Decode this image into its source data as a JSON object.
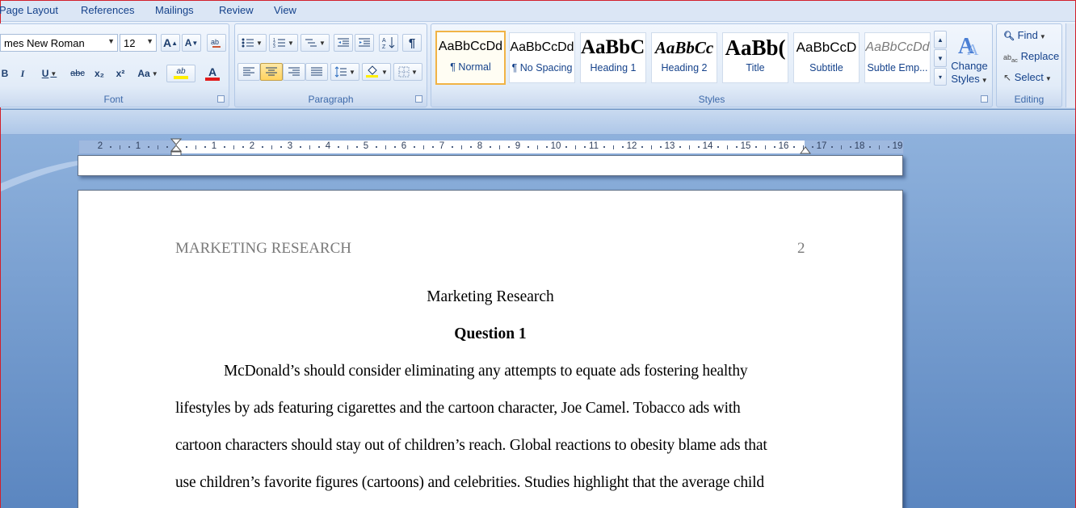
{
  "tabs": [
    "Page Layout",
    "References",
    "Mailings",
    "Review",
    "View"
  ],
  "font": {
    "name": "mes New Roman",
    "size": "12",
    "grow_label": "A",
    "shrink_label": "A",
    "bold": "B",
    "italic": "I",
    "underline": "U",
    "strikethrough": "abc",
    "subscript": "x₂",
    "superscript": "x²",
    "change_case": "Aa",
    "highlight": "ab",
    "font_color": "A",
    "group_label": "Font"
  },
  "paragraph": {
    "group_label": "Paragraph",
    "pilcrow": "¶"
  },
  "styles": {
    "group_label": "Styles",
    "items": [
      {
        "sample": "AaBbCcDd",
        "name": "¶ Normal"
      },
      {
        "sample": "AaBbCcDd",
        "name": "¶ No Spacing"
      },
      {
        "sample": "AaBbC(",
        "name": "Heading 1"
      },
      {
        "sample": "AaBbCc",
        "name": "Heading 2"
      },
      {
        "sample": "AaBb(",
        "name": "Title"
      },
      {
        "sample": "AaBbCcD",
        "name": "Subtitle"
      },
      {
        "sample": "AaBbCcDd",
        "name": "Subtle Emp..."
      }
    ],
    "change_styles": [
      "Change",
      "Styles"
    ]
  },
  "editing": {
    "group_label": "Editing",
    "find": "Find",
    "replace": "Replace",
    "select": "Select"
  },
  "ruler": {
    "labels": [
      "2",
      "1",
      "1",
      "2",
      "3",
      "4",
      "5",
      "6",
      "7",
      "8",
      "9",
      "10",
      "11",
      "12",
      "13",
      "14",
      "15",
      "16",
      "17",
      "18",
      "19"
    ]
  },
  "document": {
    "header_left": "MARKETING RESEARCH",
    "page_number": "2",
    "title": "Marketing Research",
    "question": "Question 1",
    "lines": [
      "McDonald’s should consider eliminating any attempts to equate ads fostering healthy",
      "lifestyles by ads featuring cigarettes and the cartoon character, Joe Camel. Tobacco ads with",
      "cartoon characters should stay out of children’s reach. Global reactions to obesity blame ads that",
      "use children’s favorite figures (cartoons) and celebrities. Studies highlight that the average child"
    ]
  },
  "colors": {
    "ribbon_text": "#15428b",
    "selected_style_border": "#f1b345",
    "font_color_bar": "#e21a1a",
    "highlight_bar": "#ffef00"
  }
}
